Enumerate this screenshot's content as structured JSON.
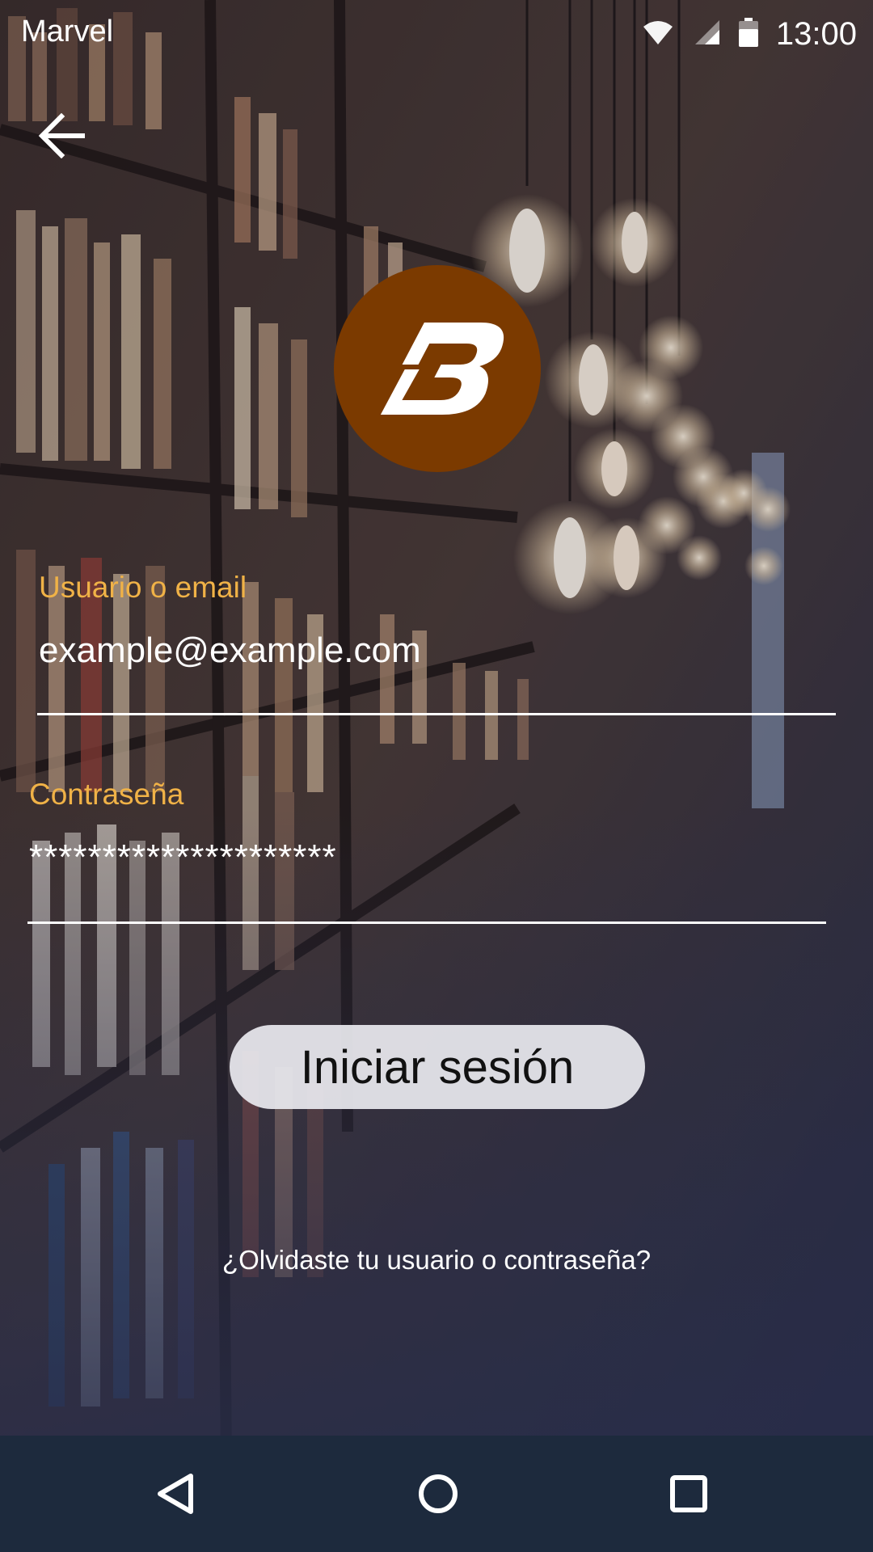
{
  "status_bar": {
    "app_name": "Marvel",
    "time": "13:00",
    "icons": [
      "wifi-icon",
      "signal-icon",
      "battery-icon"
    ]
  },
  "header": {
    "back_icon": "arrow-left-icon"
  },
  "logo": {
    "letter": "B",
    "background_color": "#7b3a00",
    "letter_color": "#ffffff"
  },
  "form": {
    "username": {
      "label": "Usuario o email",
      "value": "example@example.com"
    },
    "password": {
      "label": "Contraseña",
      "value": "*********************"
    },
    "label_color": "#f0b247",
    "login_label": "Iniciar sesión"
  },
  "forgot_link": "¿Olvidaste tu usuario o contraseña?",
  "nav_bar": {
    "icons": [
      "nav-back-icon",
      "nav-home-icon",
      "nav-recents-icon"
    ],
    "background_color": "#1d2a3d"
  }
}
